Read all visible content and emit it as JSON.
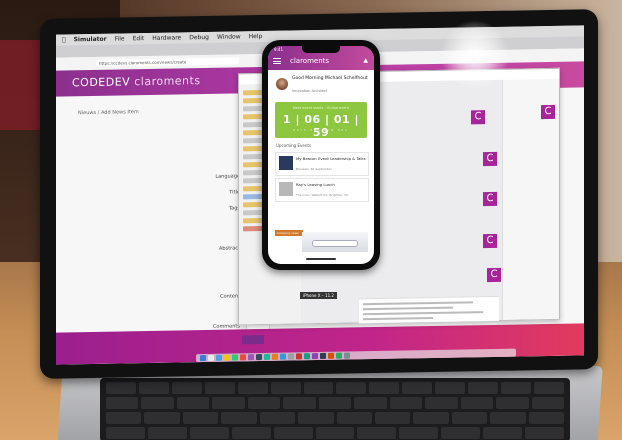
{
  "mac_menubar": {
    "items": [
      "Simulator",
      "File",
      "Edit",
      "Hardware",
      "Debug",
      "Window",
      "Help"
    ]
  },
  "browser": {
    "url": "https://ccdevs.claroments.com/news/create"
  },
  "cms": {
    "brand_prefix": "CODEDEV",
    "brand_name": "claroments",
    "breadcrumb_parent": "Nieuws",
    "breadcrumb_current": "Add News Item",
    "labels": {
      "language": "Language",
      "title": "Title",
      "tags": "Tags",
      "abstract": "Abstract",
      "content": "Content",
      "comments": "Comments"
    }
  },
  "ide": {
    "tile_letter": "C"
  },
  "phone": {
    "status_time": "9:41",
    "brand": "claroments",
    "greeting": "Good Morning Michael Schelfhout",
    "subtitle": "Innovation Architect",
    "countdown_title": "Next event starts · Online event",
    "countdown_value": "1 | 06 | 01 | 59",
    "countdown_units": "DAYS HRS MIN SEC",
    "upcoming_label": "Upcoming Events",
    "events": [
      {
        "title": "My Beacon Event Leadership & Talks",
        "location": "Brussels, 20 September"
      },
      {
        "title": "Ray's Leaving Lunch",
        "location": "The Cour, Waterfront, Brighton, UK"
      }
    ],
    "footer_tag": "Company news",
    "caption": "iPhone X – 11.2"
  }
}
